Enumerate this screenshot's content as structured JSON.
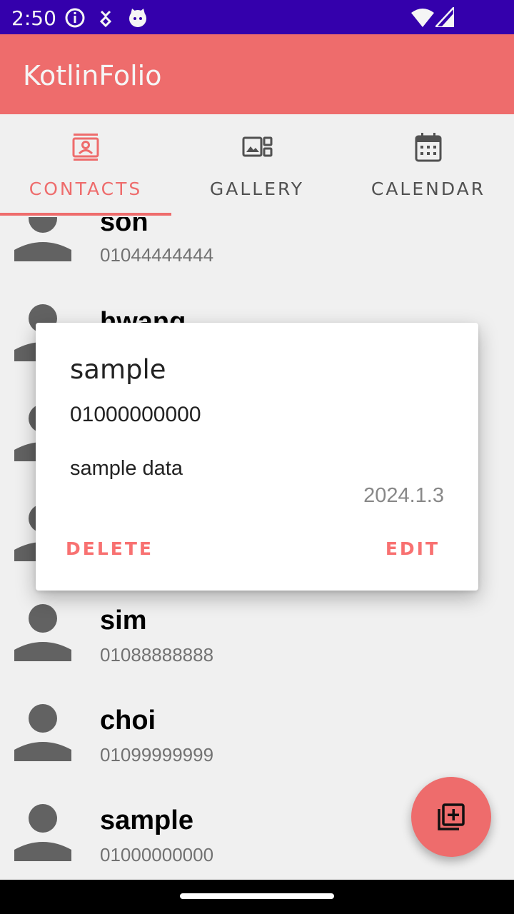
{
  "status_bar": {
    "time": "2:50",
    "icons": [
      "info-icon",
      "usb-debug-icon",
      "cat-app-icon",
      "wifi-icon",
      "signal-icon"
    ]
  },
  "app_bar": {
    "title": "KotlinFolio",
    "color": "#f87171"
  },
  "tabs": [
    {
      "label": "CONTACTS",
      "icon": "contacts-icon",
      "active": true
    },
    {
      "label": "GALLERY",
      "icon": "gallery-icon",
      "active": false
    },
    {
      "label": "CALENDAR",
      "icon": "calendar-icon",
      "active": false
    }
  ],
  "contacts": [
    {
      "name": "son",
      "phone": "01044444444"
    },
    {
      "name": "hwang",
      "phone": ""
    },
    {
      "name": "",
      "phone": ""
    },
    {
      "name": "",
      "phone": ""
    },
    {
      "name": "sim",
      "phone": "01088888888"
    },
    {
      "name": "choi",
      "phone": "01099999999"
    },
    {
      "name": "sample",
      "phone": "01000000000"
    }
  ],
  "dialog": {
    "name": "sample",
    "phone": "01000000000",
    "memo": "sample data",
    "date": "2024.1.3",
    "delete_label": "DELETE",
    "edit_label": "EDIT"
  },
  "fab": {
    "icon": "add-to-library-icon"
  },
  "colors": {
    "accent": "#f87171",
    "status_bar": "#3700b3"
  }
}
